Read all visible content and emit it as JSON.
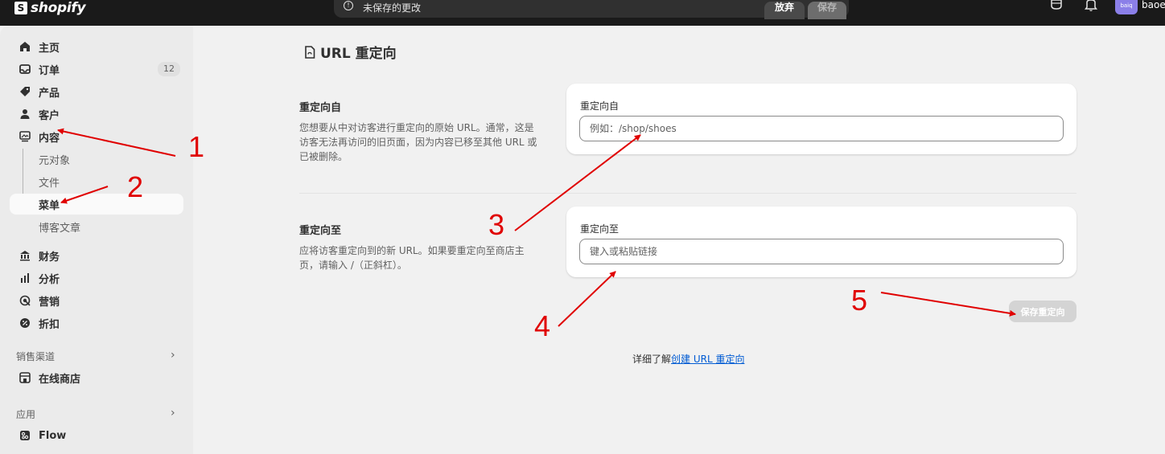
{
  "topbar": {
    "logo_text": "shopify",
    "unsaved_text": "未保存的更改",
    "discard_label": "放弃",
    "save_label": "保存",
    "avatar_text": "baiq",
    "user_name": "baoe"
  },
  "sidebar": {
    "items": [
      {
        "label": "主页",
        "icon": "home-icon"
      },
      {
        "label": "订单",
        "icon": "inbox-icon",
        "badge": "12"
      },
      {
        "label": "产品",
        "icon": "tag-icon"
      },
      {
        "label": "客户",
        "icon": "person-icon"
      },
      {
        "label": "内容",
        "icon": "image-icon"
      }
    ],
    "sub_items": [
      {
        "label": "元对象"
      },
      {
        "label": "文件"
      },
      {
        "label": "菜单"
      },
      {
        "label": "博客文章"
      }
    ],
    "items2": [
      {
        "label": "财务",
        "icon": "bank-icon"
      },
      {
        "label": "分析",
        "icon": "bar-chart-icon"
      },
      {
        "label": "营销",
        "icon": "target-icon"
      },
      {
        "label": "折扣",
        "icon": "discount-icon"
      }
    ],
    "sales_channels_label": "销售渠道",
    "online_store_label": "在线商店",
    "apps_label": "应用",
    "flow_label": "Flow"
  },
  "main": {
    "title": "URL 重定向",
    "from_section": {
      "heading": "重定向自",
      "desc": "您想要从中对访客进行重定向的原始 URL。通常，这是访客无法再访问的旧页面，因为内容已移至其他 URL 或已被删除。",
      "field_label": "重定向自",
      "placeholder": "例如：/shop/shoes"
    },
    "to_section": {
      "heading": "重定向至",
      "desc": "应将访客重定向到的新 URL。如果要重定向至商店主页，请输入 /（正斜杠）。",
      "field_label": "重定向至",
      "placeholder": "键入或粘贴链接"
    },
    "save_button": "保存重定向",
    "learn_prefix": "详细了解",
    "learn_link": "创建 URL 重定向"
  },
  "annotations": [
    "1",
    "2",
    "3",
    "4",
    "5"
  ],
  "colors": {
    "annotation": "#e00000",
    "link": "#005bd3",
    "topbar": "#1a1a1a"
  }
}
